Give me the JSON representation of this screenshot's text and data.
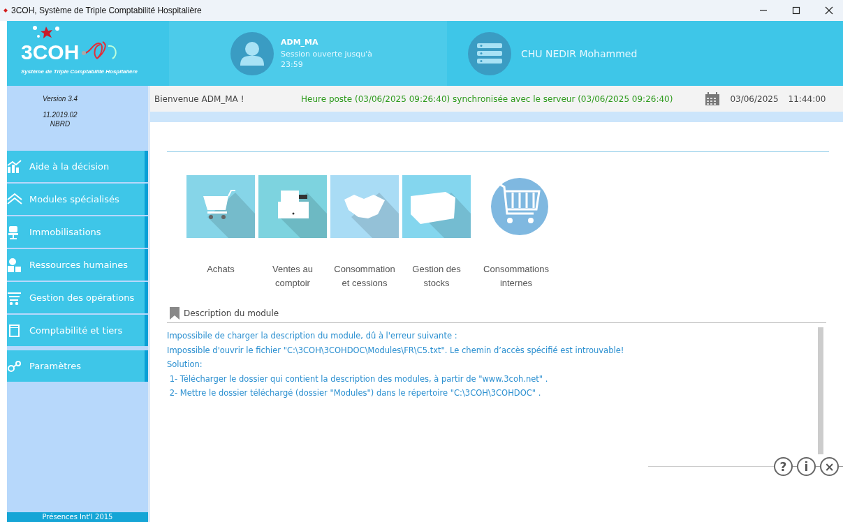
{
  "window": {
    "title": "3COH, Système de Triple Comptabilité Hospitalière"
  },
  "header": {
    "logo_text": "3COH",
    "logo_subtitle": "Système de Triple Comptabilité Hospitalière",
    "user": "ADM_MA",
    "session": "Session ouverte jusqu'à",
    "session_time": "23:59",
    "server": "CHU NEDIR Mohammed"
  },
  "version": {
    "version": "Version 3.4",
    "build": "11.2019.02",
    "code": "NBRD"
  },
  "status_bar": {
    "welcome": "Bienvenue ADM_MA !",
    "sync": "Heure poste (03/06/2025 09:26:40) synchronisée avec le serveur (03/06/2025 09:26:40)",
    "date": "03/06/2025",
    "time": "11:44:00"
  },
  "sidebar": {
    "items": [
      {
        "label": "Aide à la décision"
      },
      {
        "label": "Modules spécialisés"
      },
      {
        "label": "Immobilisations"
      },
      {
        "label": "Ressources humaines"
      },
      {
        "label": "Gestion des opérations"
      },
      {
        "label": "Comptabilité et tiers"
      },
      {
        "label": "Paramètres"
      }
    ],
    "footer": "Présences Int'l 2015"
  },
  "modules": [
    {
      "kind": "tile",
      "label": "Achats",
      "color": "#86d5e8"
    },
    {
      "kind": "tile",
      "label": "Ventes au comptoir",
      "color": "#7dd3df"
    },
    {
      "kind": "tile",
      "label": "Consommation et cessions",
      "color": "#a9dcf5"
    },
    {
      "kind": "tile",
      "label": "Gestion des stocks",
      "color": "#84d6ee"
    },
    {
      "kind": "circle",
      "label": "Consommations internes",
      "color": "#7fb8e0"
    }
  ],
  "description": {
    "title": "Description du module",
    "lines": [
      "Impossibile de charger la description du module, dû à l'erreur suivante :",
      "Impossible d'ouvrir le fichier \"C:\\3COH\\3COHDOC\\Modules\\FR\\C5.txt\". Le chemin d’accès spécifié est introuvable!",
      "Solution:",
      " 1- Télécharger le dossier qui contient la description des modules, à partir de \"www.3coh.net\" .",
      " 2- Mettre le dossier téléchargé (dossier \"Modules\") dans le répertoire \"C:\\3COH\\3COHDOC\" ."
    ]
  },
  "footer_buttons": [
    "?",
    "i",
    "×"
  ]
}
